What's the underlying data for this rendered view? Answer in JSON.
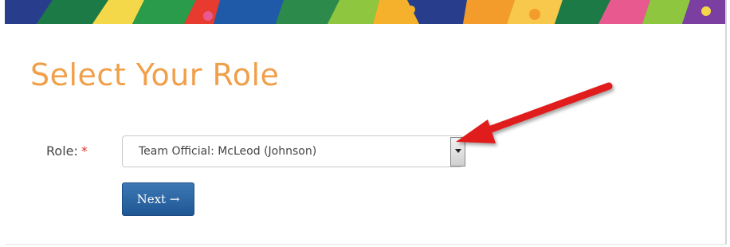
{
  "header": {
    "banner_colors": [
      "#283e8c",
      "#1b7a45",
      "#e63b2e",
      "#f5b12b",
      "#2a9b4a",
      "#f4d84a",
      "#e85a8f",
      "#8ec63f",
      "#f39c2b",
      "#1e5aa8",
      "#f8c84c",
      "#7a3fa0"
    ]
  },
  "page": {
    "title": "Select Your Role",
    "title_color": "#f0a04a"
  },
  "form": {
    "role_label": "Role:",
    "required_marker": "*",
    "role_selected_value": "Team Official: McLeod (Johnson)",
    "next_button_label": "Next →",
    "next_button_color": "#2a65a4"
  },
  "annotation": {
    "arrow_color": "#e01e1e",
    "pointing_at": "dropdown-toggle-button"
  }
}
